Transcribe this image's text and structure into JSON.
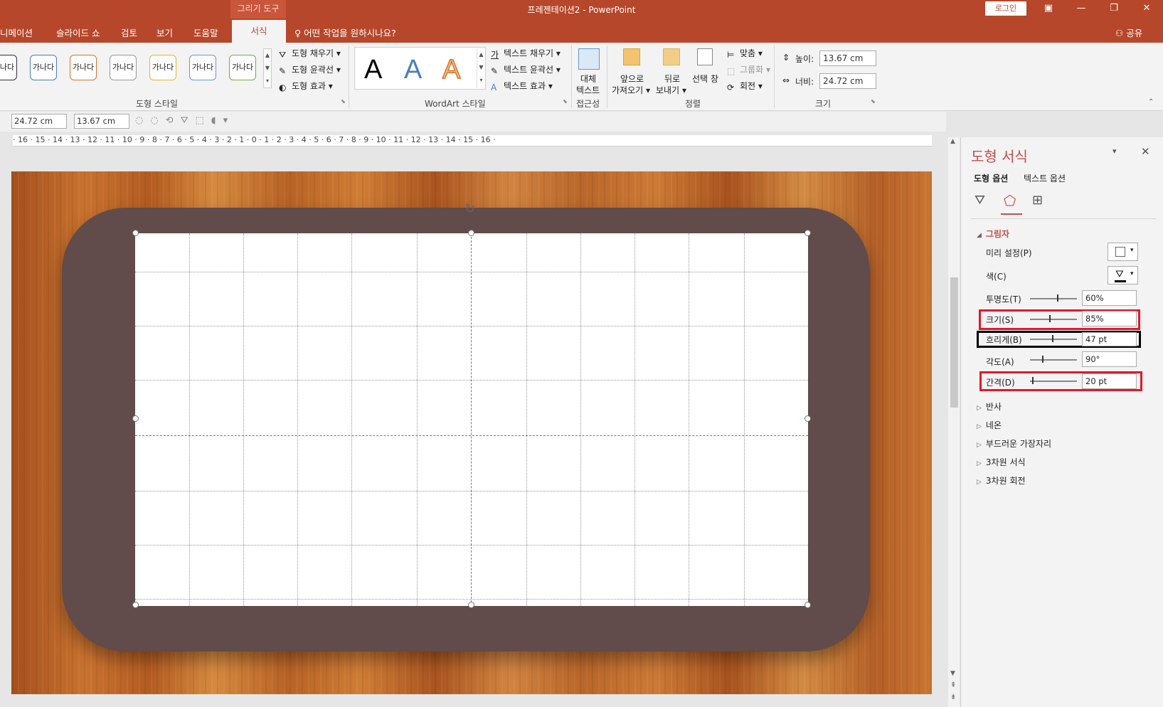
{
  "titlebar": {
    "context_tab": "그리기 도구",
    "title": "프레젠테이션2  -  PowerPoint",
    "login": "로그인"
  },
  "tabs": [
    "니메이션",
    "슬라이드 쇼",
    "검토",
    "보기",
    "도움말"
  ],
  "active_tab": "서식",
  "tellme": "어떤 작업을 원하시나요?",
  "share": "공유",
  "ribbon": {
    "shape_styles": {
      "sample": "가나다",
      "fill": "도형 채우기",
      "outline": "도형 윤곽선",
      "effect": "도형 효과",
      "label": "도형 스타일"
    },
    "wordart": {
      "letter": "A",
      "fill": "텍스트 채우기",
      "outline": "텍스트 윤곽선",
      "effect": "텍스트 효과",
      "label": "WordArt 스타일"
    },
    "accessibility": {
      "alt_text_1": "대체",
      "alt_text_2": "텍스트",
      "label": "접근성"
    },
    "arrange": {
      "bring_forward_1": "앞으로",
      "bring_forward_2": "가져오기",
      "send_backward_1": "뒤로",
      "send_backward_2": "보내기",
      "selection_pane": "선택 창",
      "align": "맞춤",
      "group": "그룹화",
      "rotate": "회전",
      "label": "정렬"
    },
    "size": {
      "height_label": "높이:",
      "height_value": "13.67 cm",
      "width_label": "너비:",
      "width_value": "24.72 cm",
      "label": "크기"
    }
  },
  "quick_toolbar": {
    "width": "24.72 cm",
    "height": "13.67 cm"
  },
  "ruler": "· 16 · 15 · 14 · 13 · 12 · 11 · 10 · 9 · 8 · 7 · 6 · 5 · 4 · 3 · 2 · 1 · 0 · 1 · 2 · 3 · 4 · 5 · 6 · 7 · 8 · 9 · 10 · 11 · 12 · 13 · 14 · 15 · 16 ·",
  "pane": {
    "title": "도형 서식",
    "tab_shape": "도형 옵션",
    "tab_text": "텍스트 옵션",
    "section_shadow": "그림자",
    "preset": "미리 설정(P)",
    "color": "색(C)",
    "transparency": {
      "label": "투명도(T)",
      "value": "60%"
    },
    "size": {
      "label": "크기(S)",
      "value": "85%"
    },
    "blur": {
      "label": "흐리게(B)",
      "value": "47 pt"
    },
    "angle": {
      "label": "각도(A)",
      "value": "90°"
    },
    "distance": {
      "label": "간격(D)",
      "value": "20 pt"
    },
    "sections": [
      "반사",
      "네온",
      "부드러운 가장자리",
      "3차원 서식",
      "3차원 회전"
    ]
  },
  "colors": {
    "accent": "#b7472a",
    "frame": "#614b4b",
    "highlight_red": "#e0192d"
  }
}
